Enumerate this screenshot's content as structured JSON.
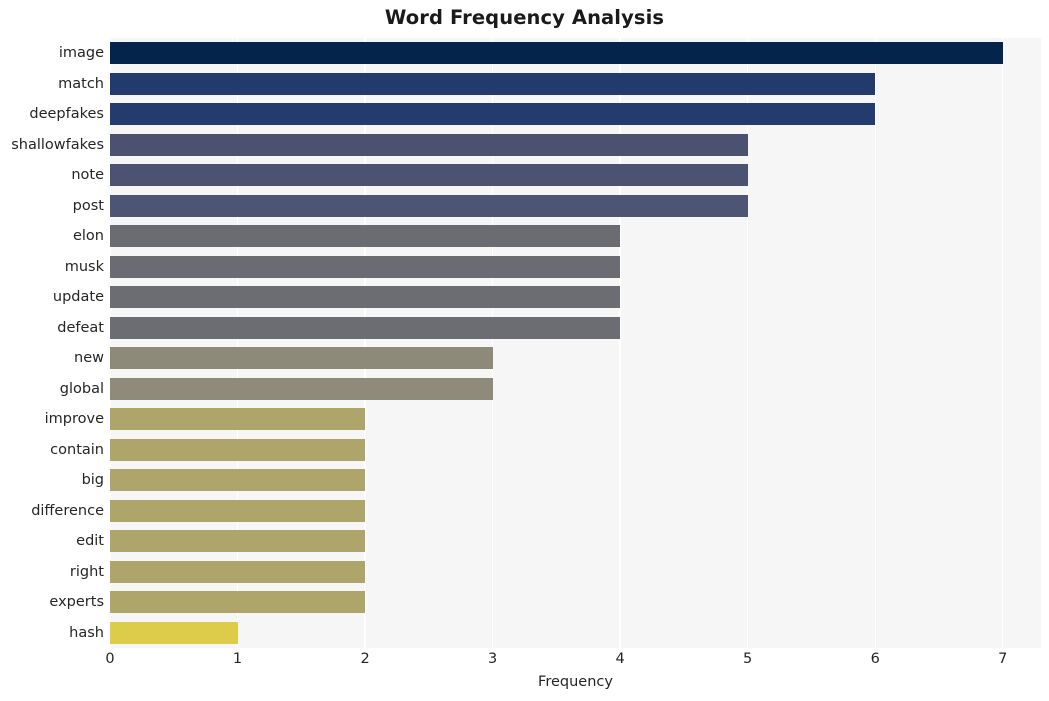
{
  "chart_data": {
    "type": "bar",
    "orientation": "horizontal",
    "title": "Word Frequency Analysis",
    "xlabel": "Frequency",
    "ylabel": "",
    "xlim": [
      0,
      7.3
    ],
    "xticks": [
      0,
      1,
      2,
      3,
      4,
      5,
      6,
      7
    ],
    "xtick_labels": [
      "0",
      "1",
      "2",
      "3",
      "4",
      "5",
      "6",
      "7"
    ],
    "grid": "vertical-only",
    "legend": "none",
    "categories": [
      "image",
      "match",
      "deepfakes",
      "shallowfakes",
      "note",
      "post",
      "elon",
      "musk",
      "update",
      "defeat",
      "new",
      "global",
      "improve",
      "contain",
      "big",
      "difference",
      "edit",
      "right",
      "experts",
      "hash"
    ],
    "values": [
      7,
      6,
      6,
      5,
      5,
      5,
      4,
      4,
      4,
      4,
      3,
      3,
      2,
      2,
      2,
      2,
      2,
      2,
      2,
      1
    ],
    "bar_colors": [
      "#05244c",
      "#233a6c",
      "#243b6e",
      "#4b5270",
      "#4c5372",
      "#4e5474",
      "#6a6c72",
      "#6a6c72",
      "#6b6d73",
      "#6b6d73",
      "#8e8a79",
      "#8f8b7a",
      "#ada569",
      "#ada569",
      "#ada569",
      "#ada569",
      "#ada569",
      "#ada569",
      "#ada569",
      "#ddcc4a"
    ],
    "plot_background": "#f6f6f7",
    "gridline_color": "#ffffff",
    "figure_background": "#ffffff",
    "text_color": "#262626"
  }
}
